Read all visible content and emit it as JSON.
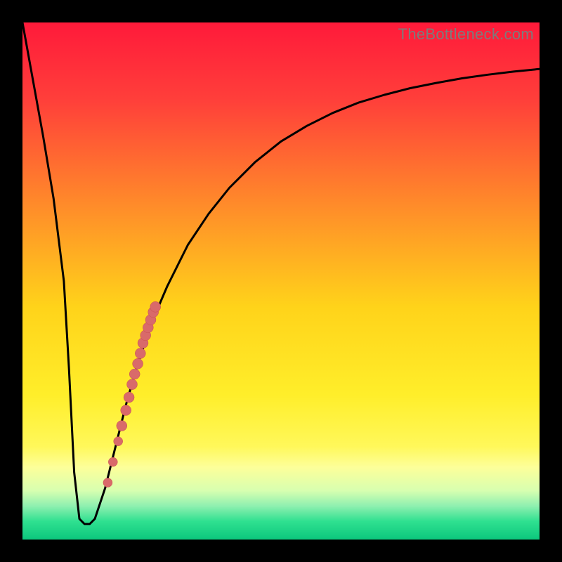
{
  "watermark": "TheBottleneck.com",
  "colors": {
    "frame": "#000000",
    "curve": "#000000",
    "dot_fill": "#d96a6a",
    "dot_stroke": "#c94f4f",
    "gradient_stops": [
      {
        "offset": 0.0,
        "color": "#ff1a3a"
      },
      {
        "offset": 0.15,
        "color": "#ff3f3a"
      },
      {
        "offset": 0.35,
        "color": "#ff8a2a"
      },
      {
        "offset": 0.55,
        "color": "#ffd31a"
      },
      {
        "offset": 0.72,
        "color": "#ffee2a"
      },
      {
        "offset": 0.82,
        "color": "#fff85a"
      },
      {
        "offset": 0.86,
        "color": "#fdff9a"
      },
      {
        "offset": 0.905,
        "color": "#d8ffb0"
      },
      {
        "offset": 0.935,
        "color": "#8ff0b0"
      },
      {
        "offset": 0.965,
        "color": "#2fe090"
      },
      {
        "offset": 1.0,
        "color": "#0cc77d"
      }
    ]
  },
  "chart_data": {
    "type": "line",
    "title": "",
    "xlabel": "",
    "ylabel": "",
    "xlim": [
      0,
      100
    ],
    "ylim": [
      0,
      100
    ],
    "series": [
      {
        "name": "bottleneck-curve",
        "x": [
          0,
          2,
          4,
          6,
          8,
          9,
          10,
          11,
          12,
          13,
          14,
          16,
          18,
          20,
          22,
          25,
          28,
          32,
          36,
          40,
          45,
          50,
          55,
          60,
          65,
          70,
          75,
          80,
          85,
          90,
          95,
          100
        ],
        "y": [
          100,
          89,
          78,
          66,
          50,
          33,
          13,
          4,
          3,
          3,
          4,
          10,
          18,
          26,
          33,
          42,
          49,
          57,
          63,
          68,
          73,
          77,
          80,
          82.5,
          84.5,
          86,
          87.3,
          88.3,
          89.2,
          89.9,
          90.5,
          91
        ]
      }
    ],
    "highlight_points": {
      "name": "dot-cluster",
      "points": [
        {
          "x": 16.5,
          "y": 11
        },
        {
          "x": 17.5,
          "y": 15
        },
        {
          "x": 18.5,
          "y": 19
        },
        {
          "x": 19.2,
          "y": 22
        },
        {
          "x": 20.0,
          "y": 25
        },
        {
          "x": 20.6,
          "y": 27.5
        },
        {
          "x": 21.2,
          "y": 30
        },
        {
          "x": 21.7,
          "y": 32
        },
        {
          "x": 22.3,
          "y": 34
        },
        {
          "x": 22.8,
          "y": 36
        },
        {
          "x": 23.3,
          "y": 38
        },
        {
          "x": 23.8,
          "y": 39.5
        },
        {
          "x": 24.3,
          "y": 41
        },
        {
          "x": 24.8,
          "y": 42.5
        },
        {
          "x": 25.3,
          "y": 44
        },
        {
          "x": 25.7,
          "y": 45
        }
      ]
    }
  }
}
